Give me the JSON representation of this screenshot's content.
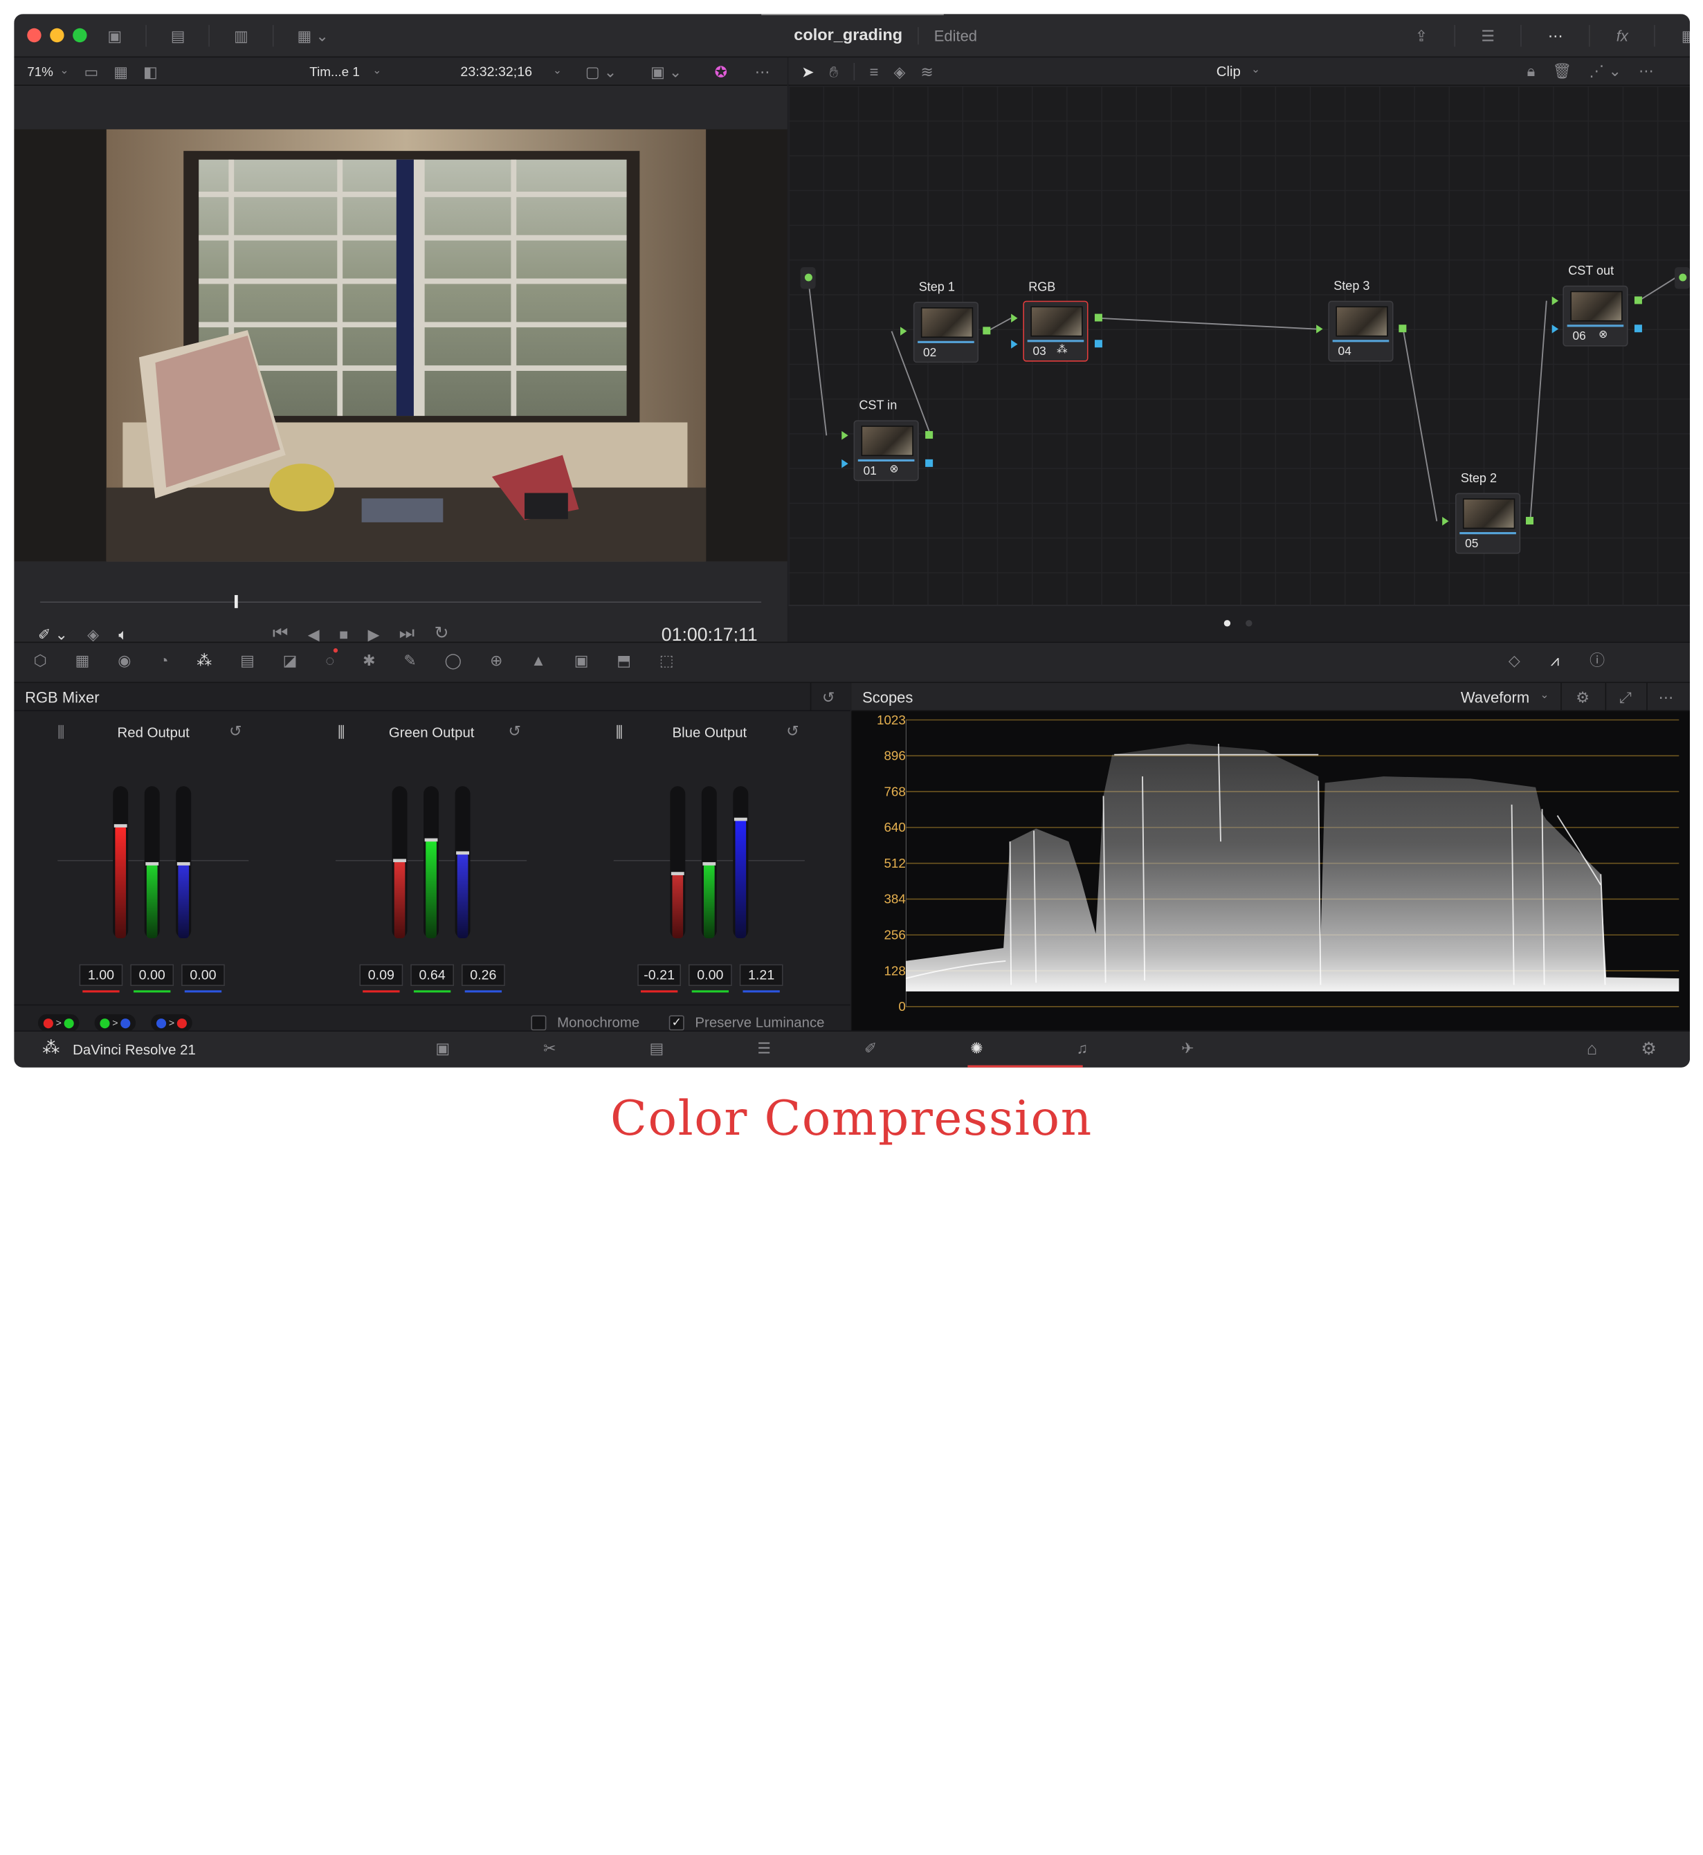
{
  "window": {
    "title": "color_grading",
    "status": "Edited"
  },
  "viewer_bar": {
    "zoom": "71%",
    "timeline_name": "Tim...e 1",
    "source_timecode": "23:32:32;16"
  },
  "node_bar": {
    "mode": "Clip"
  },
  "nodes": [
    {
      "label": "CST in",
      "number": "01"
    },
    {
      "label": "Step 1",
      "number": "02"
    },
    {
      "label": "RGB",
      "number": "03"
    },
    {
      "label": "Step 3",
      "number": "04"
    },
    {
      "label": "Step 2",
      "number": "05"
    },
    {
      "label": "CST out",
      "number": "06"
    }
  ],
  "transport": {
    "timecode": "01:00:17;11",
    "playhead_fraction": 0.27
  },
  "mixer": {
    "title": "RGB Mixer",
    "groups": [
      {
        "title": "Red Output",
        "values": [
          "1.00",
          "0.00",
          "0.00"
        ]
      },
      {
        "title": "Green Output",
        "values": [
          "0.09",
          "0.64",
          "0.26"
        ]
      },
      {
        "title": "Blue Output",
        "values": [
          "-0.21",
          "0.00",
          "1.21"
        ]
      }
    ],
    "monochrome_label": "Monochrome",
    "monochrome_checked": false,
    "preserve_label": "Preserve Luminance",
    "preserve_checked": true
  },
  "scopes": {
    "title": "Scopes",
    "mode": "Waveform",
    "ticks": [
      "1023",
      "896",
      "768",
      "640",
      "512",
      "384",
      "256",
      "128",
      "0"
    ]
  },
  "app": {
    "name": "DaVinci Resolve 21"
  },
  "caption": "Color Compression",
  "colors": {
    "red": "#e52424",
    "green": "#1fcf2a",
    "blue": "#2b2be0",
    "accent_red": "#e23d3d",
    "scope_gold": "#e6b150"
  }
}
